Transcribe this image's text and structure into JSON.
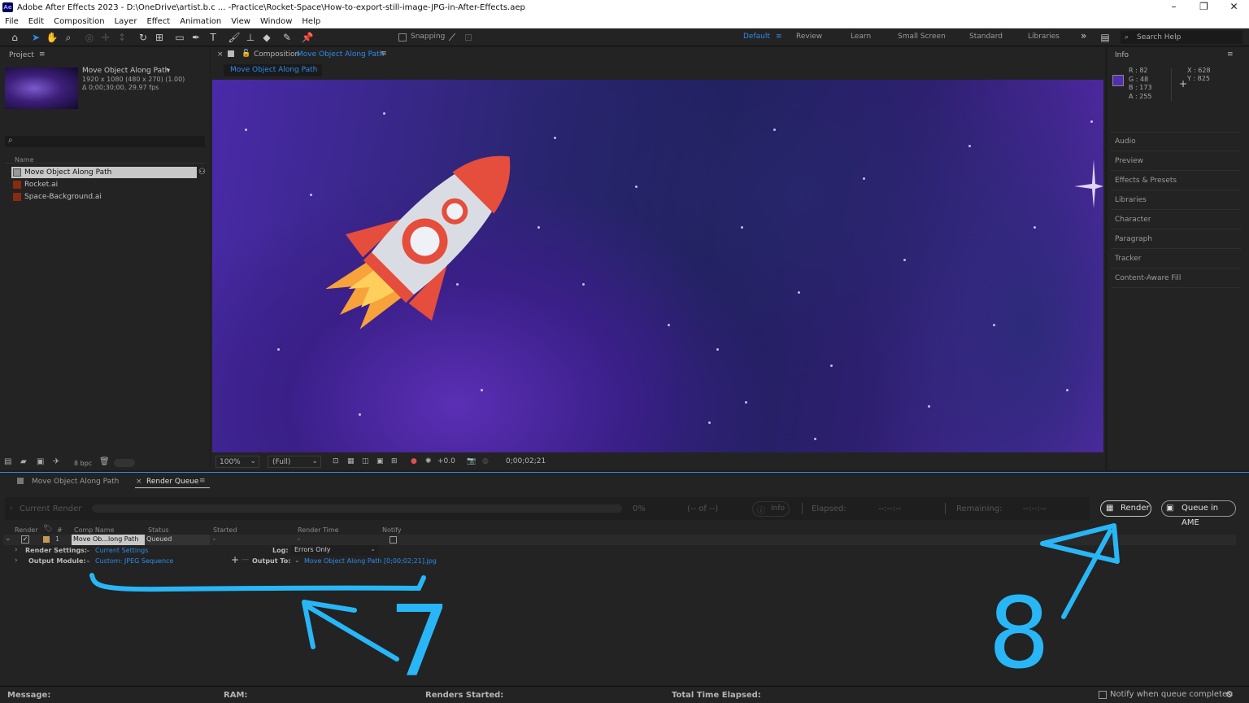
{
  "window": {
    "app_icon": "Ae",
    "title": "Adobe After Effects 2023 - D:\\OneDrive\\artist.b.c ... -Practice\\Rocket-Space\\How-to-export-still-image-JPG-in-After-Effects.aep",
    "minimize": "–",
    "restore": "❐",
    "close": "✕"
  },
  "menu": [
    "File",
    "Edit",
    "Composition",
    "Layer",
    "Effect",
    "Animation",
    "View",
    "Window",
    "Help"
  ],
  "toolbar": {
    "snapping": "Snapping",
    "workspaces": [
      "Default",
      "Review",
      "Learn",
      "Small Screen",
      "Standard",
      "Libraries"
    ],
    "more": "»",
    "search_help": "Search Help"
  },
  "project": {
    "title": "Project",
    "item_name": "Move Object Along Path",
    "item_res": "1920 x 1080  (480 x 270) (1.00)",
    "item_dur": "Δ 0;00;30;00, 29.97 fps",
    "col_name": "Name",
    "items": [
      "Move Object Along Path",
      "Rocket.ai",
      "Space-Background.ai"
    ],
    "bpc": "8 bpc"
  },
  "composition": {
    "tab_prefix": "Composition",
    "tab_name": "Move Object Along Path",
    "sub_tab": "Move Object Along Path",
    "zoom": "100%",
    "resolution": "(Full)",
    "exposure": "+0.0",
    "timecode": "0;00;02;21"
  },
  "info": {
    "title": "Info",
    "r": "R : 82",
    "g": "G : 48",
    "b": "B : 173",
    "a": "A : 255",
    "x": "X : 628",
    "y": "Y : 825",
    "swatch_color": "#5230ad",
    "panels": [
      "Audio",
      "Preview",
      "Effects & Presets",
      "Libraries",
      "Character",
      "Paragraph",
      "Tracker",
      "Content-Aware Fill"
    ]
  },
  "render_queue": {
    "tab_comp": "Move Object Along Path",
    "tab_rq": "Render Queue",
    "current_render": "Current Render",
    "progress": "0%",
    "of": "(-- of --)",
    "info_btn": "Info",
    "elapsed_label": "Elapsed:",
    "elapsed_val": "--:--:--",
    "remaining_label": "Remaining:",
    "remaining_val": "--:--:--",
    "render_btn": "Render",
    "ame_btn": "Queue in AME",
    "columns": [
      "Render",
      "#",
      "Comp Name",
      "Status",
      "Started",
      "Render Time",
      "Notify"
    ],
    "row_num": "1",
    "row_comp": "Move Ob...long Path",
    "row_status": "Queued",
    "row_started": "-",
    "row_time": "-",
    "render_settings_label": "Render Settings:",
    "render_settings_val": "Current Settings",
    "output_module_label": "Output Module:",
    "output_module_val": "Custom: JPEG Sequence",
    "log_label": "Log:",
    "log_val": "Errors Only",
    "output_to_label": "Output To:",
    "output_to_val": "Move Object Along Path [0;00;02;21].jpg"
  },
  "annotations": {
    "num7": "7",
    "num8": "8",
    "color": "#29b6f6"
  },
  "statusbar": {
    "message": "Message:",
    "ram": "RAM:",
    "renders_started": "Renders Started:",
    "total_time": "Total Time Elapsed:",
    "notify": "Notify when queue completes"
  }
}
